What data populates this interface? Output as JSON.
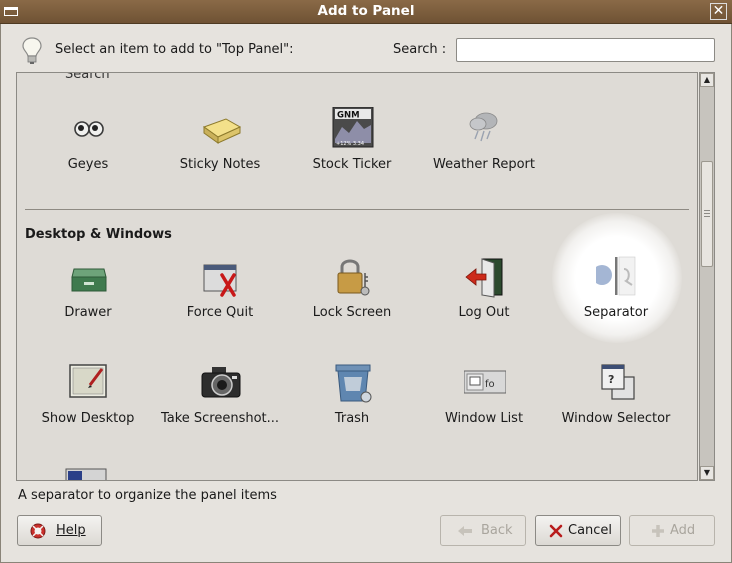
{
  "window": {
    "title": "Add to Panel"
  },
  "header": {
    "prompt": "Select an item to add to \"Top Panel\":",
    "search_label": "Search :",
    "search_value": ""
  },
  "list": {
    "cut_label": "Search",
    "row1": [
      {
        "label": "Geyes",
        "icon": "geyes-icon"
      },
      {
        "label": "Sticky Notes",
        "icon": "sticky-notes-icon"
      },
      {
        "label": "Stock Ticker",
        "icon": "stock-ticker-icon",
        "ticker_symbol": "GNM",
        "ticker_text": "+12% 3.34"
      },
      {
        "label": "Weather Report",
        "icon": "weather-icon"
      }
    ],
    "section_title": "Desktop & Windows",
    "row2": [
      {
        "label": "Drawer",
        "icon": "drawer-icon"
      },
      {
        "label": "Force Quit",
        "icon": "force-quit-icon"
      },
      {
        "label": "Lock Screen",
        "icon": "lock-icon"
      },
      {
        "label": "Log Out",
        "icon": "logout-icon"
      },
      {
        "label": "Separator",
        "icon": "separator-icon",
        "selected": true
      }
    ],
    "row3": [
      {
        "label": "Show Desktop",
        "icon": "show-desktop-icon"
      },
      {
        "label": "Take Screenshot...",
        "icon": "camera-icon"
      },
      {
        "label": "Trash",
        "icon": "trash-icon"
      },
      {
        "label": "Window List",
        "icon": "window-list-icon"
      },
      {
        "label": "Window Selector",
        "icon": "window-selector-icon"
      }
    ]
  },
  "description": "A separator to organize the panel items",
  "buttons": {
    "help": "Help",
    "back": "Back",
    "cancel": "Cancel",
    "add": "Add"
  },
  "colors": {
    "titlebar": "#7a5c3c",
    "dialog_bg": "#e6e3de",
    "selection_glow": "#ffffff"
  }
}
